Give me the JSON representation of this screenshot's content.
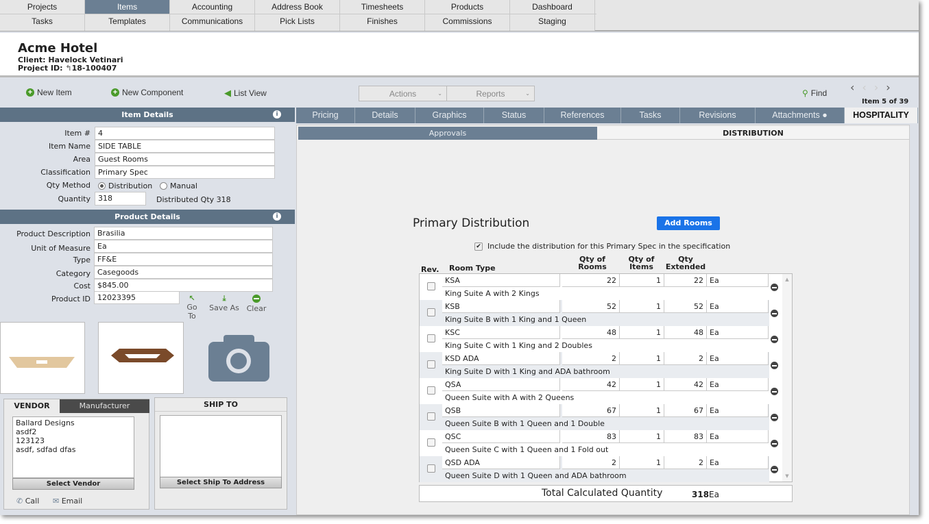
{
  "nav": {
    "row1": [
      "Projects",
      "Items",
      "Accounting",
      "Address Book",
      "Timesheets",
      "Products",
      "Dashboard"
    ],
    "row2": [
      "Tasks",
      "Templates",
      "Communications",
      "Pick Lists",
      "Finishes",
      "Commissions",
      "Staging"
    ],
    "active": "Items"
  },
  "project": {
    "title": "Acme Hotel",
    "client": "Client: Havelock Vetinari",
    "project_id_label": "Project ID:",
    "project_id": "18-100407"
  },
  "toolbar": {
    "new_item": "New Item",
    "new_component": "New Component",
    "list_view": "List View",
    "actions": "Actions",
    "reports": "Reports",
    "find": "Find",
    "item_counter": "Item 5 of 39"
  },
  "item_details": {
    "title": "Item Details",
    "item_no_label": "Item #",
    "item_no": "4",
    "item_name_label": "Item Name",
    "item_name": "SIDE TABLE",
    "area_label": "Area",
    "area": "Guest Rooms",
    "classification_label": "Classification",
    "classification": "Primary Spec",
    "qty_method_label": "Qty Method",
    "qty_method_options": [
      "Distribution",
      "Manual"
    ],
    "qty_method_selected": "Distribution",
    "quantity_label": "Quantity",
    "quantity": "318",
    "distributed_qty": "Distributed Qty  318"
  },
  "product_details": {
    "title": "Product Details",
    "description_label": "Product Description",
    "description": "Brasilia",
    "uom_label": "Unit of Measure",
    "uom": "Ea",
    "type_label": "Type",
    "type": "FF&E",
    "category_label": "Category",
    "category": "Casegoods",
    "cost_label": "Cost",
    "cost": "$845.00",
    "product_id_label": "Product ID",
    "product_id": "12023395",
    "goto": "Go To",
    "save_as": "Save As",
    "clear": "Clear"
  },
  "vendor": {
    "tab_vendor": "VENDOR",
    "tab_manufacturer": "Manufacturer",
    "lines": [
      "Ballard Designs",
      "asdf2",
      "123123",
      "asdf, sdfad dfas"
    ],
    "select": "Select Vendor",
    "call": "Call",
    "email": "Email"
  },
  "ship_to": {
    "title": "SHIP TO",
    "select": "Select Ship To Address"
  },
  "tabs": [
    "Pricing",
    "Details",
    "Graphics",
    "Status",
    "References",
    "Tasks",
    "Revisions",
    "Attachments ●",
    "HOSPITALITY"
  ],
  "active_tab": "HOSPITALITY",
  "subtabs": [
    "Approvals",
    "DISTRIBUTION"
  ],
  "active_subtab": "DISTRIBUTION",
  "distribution": {
    "title": "Primary Distribution",
    "add_rooms": "Add Rooms",
    "include_label": "Include the distribution for this Primary Spec in the specification",
    "include_checked": true,
    "headers": {
      "rev": "Rev.",
      "room_type": "Room Type",
      "qty_rooms": "Qty of Rooms",
      "qty_items": "Qty of Items",
      "qty_extended": "Qty Extended"
    },
    "rows": [
      {
        "code": "KSA",
        "desc": "King Suite A with 2 Kings",
        "rooms": "22",
        "items": "1",
        "extended": "22",
        "unit": "Ea"
      },
      {
        "code": "KSB",
        "desc": "King Suite B with 1 King and 1 Queen",
        "rooms": "52",
        "items": "1",
        "extended": "52",
        "unit": "Ea"
      },
      {
        "code": "KSC",
        "desc": "King Suite C with 1 King and 2 Doubles",
        "rooms": "48",
        "items": "1",
        "extended": "48",
        "unit": "Ea"
      },
      {
        "code": "KSD ADA",
        "desc": "King Suite D with 1 King and  ADA bathroom",
        "rooms": "2",
        "items": "1",
        "extended": "2",
        "unit": "Ea"
      },
      {
        "code": "QSA",
        "desc": "Queen Suite with A with 2 Queens",
        "rooms": "42",
        "items": "1",
        "extended": "42",
        "unit": "Ea"
      },
      {
        "code": "QSB",
        "desc": "Queen Suite B with 1 Queen and 1 Double",
        "rooms": "67",
        "items": "1",
        "extended": "67",
        "unit": "Ea"
      },
      {
        "code": "QSC",
        "desc": "Queen Suite C with 1 Queen and 1 Fold out",
        "rooms": "83",
        "items": "1",
        "extended": "83",
        "unit": "Ea"
      },
      {
        "code": "QSD ADA",
        "desc": "Queen Suite D with 1 Queen and ADA bathroom",
        "rooms": "2",
        "items": "1",
        "extended": "2",
        "unit": "Ea"
      }
    ],
    "total_label": "Total Calculated Quantity",
    "total": "318",
    "total_unit": "Ea"
  },
  "colors": {
    "nav_active": "#6b7f93",
    "section_header": "#5d7285",
    "primary_button": "#1a73e8",
    "green_icon": "#4a9a2a"
  }
}
